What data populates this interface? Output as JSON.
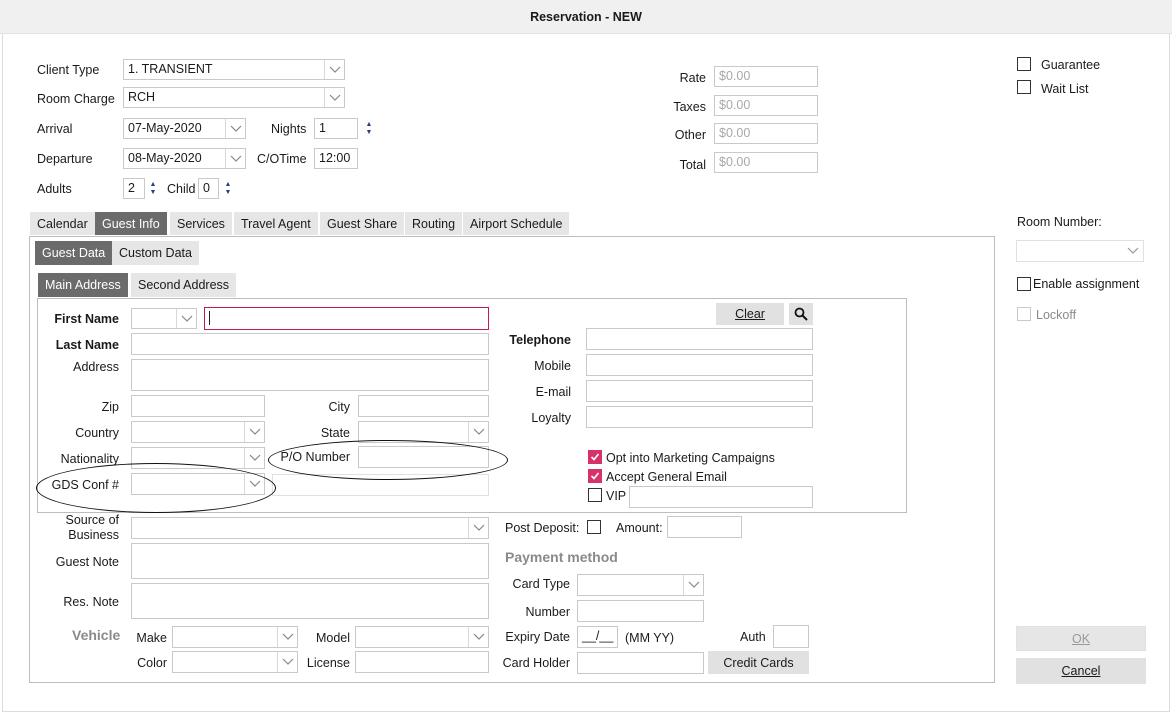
{
  "window": {
    "title": "Reservation - NEW"
  },
  "header": {
    "client_type": {
      "label": "Client Type",
      "value": "1. TRANSIENT"
    },
    "room_charge": {
      "label": "Room Charge",
      "value": "RCH"
    },
    "arrival": {
      "label": "Arrival",
      "value": "07-May-2020"
    },
    "nights": {
      "label": "Nights",
      "value": "1"
    },
    "departure": {
      "label": "Departure",
      "value": "08-May-2020"
    },
    "co_time": {
      "label": "C/OTime",
      "value": "12:00"
    },
    "adults": {
      "label": "Adults",
      "value": "2"
    },
    "child": {
      "label": "Child",
      "value": "0"
    }
  },
  "rates": {
    "rate": {
      "label": "Rate",
      "value": "$0.00"
    },
    "taxes": {
      "label": "Taxes",
      "value": "$0.00"
    },
    "other": {
      "label": "Other",
      "value": "$0.00"
    },
    "total": {
      "label": "Total",
      "value": "$0.00"
    }
  },
  "options": {
    "guarantee": {
      "label": "Guarantee",
      "checked": false
    },
    "wait_list": {
      "label": "Wait List",
      "checked": false
    }
  },
  "tabs": [
    {
      "label": "Calendar"
    },
    {
      "label": "Guest Info"
    },
    {
      "label": "Services"
    },
    {
      "label": "Travel Agent"
    },
    {
      "label": "Guest Share"
    },
    {
      "label": "Routing"
    },
    {
      "label": "Airport Schedule"
    }
  ],
  "subtabs": [
    {
      "label": "Guest Data"
    },
    {
      "label": "Custom Data"
    }
  ],
  "address_tabs": [
    {
      "label": "Main Address"
    },
    {
      "label": "Second Address"
    }
  ],
  "guest": {
    "first_name": "First Name",
    "last_name": "Last Name",
    "address": "Address",
    "zip": "Zip",
    "city": "City",
    "country": "Country",
    "state": "State",
    "nationality": "Nationality",
    "po_number": "P/O Number",
    "gds_conf": "GDS Conf #",
    "telephone": "Telephone",
    "mobile": "Mobile",
    "email": "E-mail",
    "loyalty": "Loyalty",
    "clear_button": "Clear",
    "opt_marketing": {
      "label": "Opt into Marketing Campaigns",
      "checked": true
    },
    "accept_email": {
      "label": "Accept General Email",
      "checked": true
    },
    "vip": {
      "label": "VIP",
      "checked": false
    }
  },
  "lower": {
    "source_of_business": "Source of Business",
    "guest_note": "Guest Note",
    "res_note": "Res. Note",
    "vehicle": "Vehicle",
    "make": "Make",
    "model": "Model",
    "color": "Color",
    "license": "License",
    "post_deposit": "Post Deposit:",
    "amount": "Amount:",
    "payment_method": "Payment method",
    "card_type": "Card Type",
    "number": "Number",
    "expiry_date": "Expiry Date",
    "expiry_value": "__/__",
    "expiry_format": "(MM YY)",
    "auth": "Auth",
    "card_holder": "Card Holder",
    "credit_cards_button": "Credit Cards"
  },
  "room": {
    "room_number": "Room Number:",
    "enable_assignment": {
      "label": "Enable assignment",
      "checked": false
    },
    "lockoff": {
      "label": "Lockoff",
      "checked": false
    }
  },
  "buttons": {
    "ok": "OK",
    "cancel": "Cancel"
  },
  "colors": {
    "accent": "#d6336c",
    "active_tab": "#6b6b6b",
    "spin_arrow": "#2b3b8f"
  }
}
